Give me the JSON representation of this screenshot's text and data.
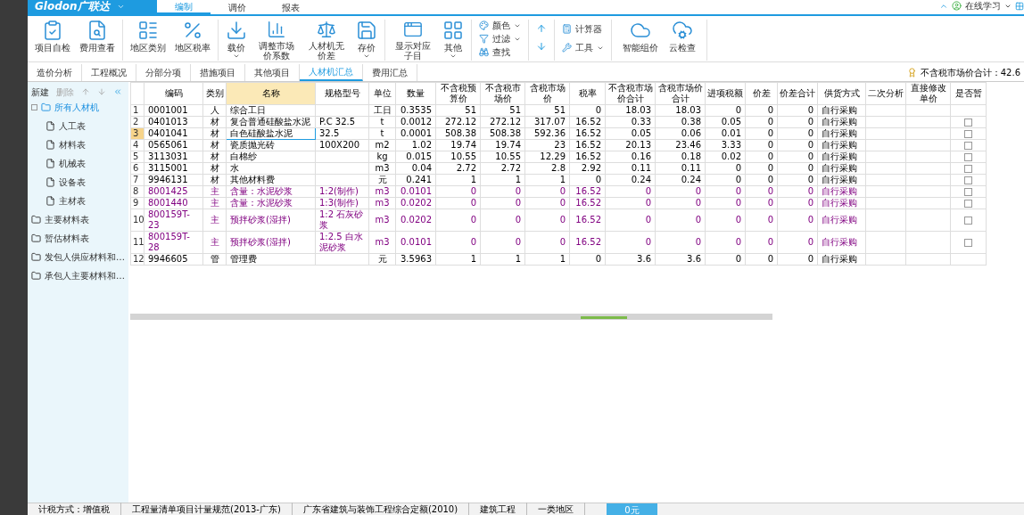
{
  "app": {
    "logo": "Glodon广联达",
    "menu_tabs": [
      {
        "label": "编制",
        "selected": true
      },
      {
        "label": "调价",
        "selected": false
      },
      {
        "label": "报表",
        "selected": false
      }
    ],
    "online_learning": "在线学习"
  },
  "ribbon": {
    "groups": [
      {
        "items": [
          {
            "label": "项目自检",
            "dropdown": false
          },
          {
            "label": "费用查看",
            "dropdown": false
          }
        ]
      },
      {
        "items": [
          {
            "label": "地区类别",
            "dropdown": false
          },
          {
            "label": "地区税率",
            "dropdown": false
          }
        ]
      },
      {
        "items": [
          {
            "label": "载价",
            "dropdown": true
          },
          {
            "label": "调整市场价系数",
            "dropdown": false
          },
          {
            "label": "人材机无价差",
            "dropdown": false
          },
          {
            "label": "存价",
            "dropdown": true
          }
        ]
      },
      {
        "items": [
          {
            "label": "显示对应子目",
            "dropdown": false
          },
          {
            "label": "其他",
            "dropdown": true
          }
        ]
      }
    ],
    "small_items": [
      {
        "label": "颜色",
        "dropdown": true
      },
      {
        "label": "过滤",
        "dropdown": true
      },
      {
        "label": "查找",
        "dropdown": false
      }
    ],
    "tool_items": [
      {
        "label": "计算器",
        "dropdown": false
      },
      {
        "label": "工具",
        "dropdown": true
      }
    ],
    "end_items": [
      {
        "label": "智能组价",
        "dropdown": false
      },
      {
        "label": "云检查",
        "dropdown": false
      }
    ]
  },
  "view_tabs": [
    {
      "label": "造价分析",
      "selected": false
    },
    {
      "label": "工程概况",
      "selected": false
    },
    {
      "label": "分部分项",
      "selected": false
    },
    {
      "label": "措施项目",
      "selected": false
    },
    {
      "label": "其他项目",
      "selected": false
    },
    {
      "label": "人材机汇总",
      "selected": true
    },
    {
      "label": "费用汇总",
      "selected": false
    }
  ],
  "total": "不含税市场价合计：42.6",
  "sidebar": {
    "toolbar": [
      "新建",
      "删除"
    ],
    "tree": [
      {
        "label": "所有人材机",
        "selected": true,
        "expanded": true,
        "children": [
          {
            "label": "人工表",
            "selected": false
          },
          {
            "label": "材料表",
            "selected": false
          },
          {
            "label": "机械表",
            "selected": false
          },
          {
            "label": "设备表",
            "selected": false
          },
          {
            "label": "主材表",
            "selected": false
          }
        ]
      },
      {
        "label": "主要材料表",
        "selected": false
      },
      {
        "label": "暂估材料表",
        "selected": false
      },
      {
        "label": "发包人供应材料和…",
        "selected": false
      },
      {
        "label": "承包人主要材料和…",
        "selected": false
      }
    ]
  },
  "table": {
    "columns": [
      "编码",
      "类别",
      "名称",
      "规格型号",
      "单位",
      "数量",
      "不含税预算价",
      "不含税市场价",
      "含税市场价",
      "税率",
      "不含税市场价合计",
      "含税市场价合计",
      "进项税额",
      "价差",
      "价差合计",
      "供货方式",
      "二次分析",
      "直接修改单价",
      "是否暂"
    ],
    "rows": [
      {
        "no": "1",
        "selected": false,
        "kind": "normal",
        "cells": [
          "0001001",
          "人",
          "综合工日",
          "",
          "工日",
          "0.3535",
          "51",
          "51",
          "51",
          "0",
          "18.03",
          "18.03",
          "0",
          "0",
          "0",
          "自行采购",
          "",
          ""
        ]
      },
      {
        "no": "2",
        "selected": false,
        "kind": "normal",
        "provisional": false,
        "cells": [
          "0401013",
          "材",
          "复合普通硅酸盐水泥",
          "P.C 32.5",
          "t",
          "0.0012",
          "272.12",
          "272.12",
          "317.07",
          "16.52",
          "0.33",
          "0.38",
          "0.05",
          "0",
          "0",
          "自行采购",
          "",
          ""
        ]
      },
      {
        "no": "3",
        "selected": true,
        "kind": "normal",
        "provisional": false,
        "cells": [
          "0401041",
          "材",
          "白色硅酸盐水泥",
          "32.5",
          "t",
          "0.0001",
          "508.38",
          "508.38",
          "592.36",
          "16.52",
          "0.05",
          "0.06",
          "0.01",
          "0",
          "0",
          "自行采购",
          "",
          ""
        ]
      },
      {
        "no": "4",
        "selected": false,
        "kind": "normal",
        "provisional": false,
        "cells": [
          "0565061",
          "材",
          "瓷质抛光砖",
          "100X200",
          "m2",
          "1.02",
          "19.74",
          "19.74",
          "23",
          "16.52",
          "20.13",
          "23.46",
          "3.33",
          "0",
          "0",
          "自行采购",
          "",
          ""
        ]
      },
      {
        "no": "5",
        "selected": false,
        "kind": "normal",
        "provisional": false,
        "cells": [
          "3113031",
          "材",
          "白棉纱",
          "",
          "kg",
          "0.015",
          "10.55",
          "10.55",
          "12.29",
          "16.52",
          "0.16",
          "0.18",
          "0.02",
          "0",
          "0",
          "自行采购",
          "",
          ""
        ]
      },
      {
        "no": "6",
        "selected": false,
        "kind": "normal",
        "provisional": false,
        "cells": [
          "3115001",
          "材",
          "水",
          "",
          "m3",
          "0.04",
          "2.72",
          "2.72",
          "2.8",
          "2.92",
          "0.11",
          "0.11",
          "0",
          "0",
          "0",
          "自行采购",
          "",
          ""
        ]
      },
      {
        "no": "7",
        "selected": false,
        "kind": "normal",
        "provisional": false,
        "cells": [
          "9946131",
          "材",
          "其他材料费",
          "",
          "元",
          "0.241",
          "1",
          "1",
          "1",
          "0",
          "0.24",
          "0.24",
          "0",
          "0",
          "0",
          "自行采购",
          "",
          ""
        ]
      },
      {
        "no": "8",
        "selected": false,
        "kind": "main",
        "provisional": false,
        "cells": [
          "8001425",
          "主",
          "含量：水泥砂浆",
          "1:2(制作)",
          "m3",
          "0.0101",
          "0",
          "0",
          "0",
          "16.52",
          "0",
          "0",
          "0",
          "0",
          "0",
          "自行采购",
          "",
          ""
        ]
      },
      {
        "no": "9",
        "selected": false,
        "kind": "main",
        "provisional": false,
        "cells": [
          "8001440",
          "主",
          "含量：水泥砂浆",
          "1:3(制作)",
          "m3",
          "0.0202",
          "0",
          "0",
          "0",
          "16.52",
          "0",
          "0",
          "0",
          "0",
          "0",
          "自行采购",
          "",
          ""
        ]
      },
      {
        "no": "10",
        "selected": false,
        "kind": "main",
        "provisional": false,
        "cells": [
          "800159T-23",
          "主",
          "预拌砂浆(湿拌)",
          "1:2 石灰砂浆",
          "m3",
          "0.0202",
          "0",
          "0",
          "0",
          "16.52",
          "0",
          "0",
          "0",
          "0",
          "0",
          "自行采购",
          "",
          ""
        ]
      },
      {
        "no": "11",
        "selected": false,
        "kind": "main",
        "provisional": false,
        "cells": [
          "800159T-28",
          "主",
          "预拌砂浆(湿拌)",
          "1:2.5 白水泥砂浆",
          "m3",
          "0.0101",
          "0",
          "0",
          "0",
          "16.52",
          "0",
          "0",
          "0",
          "0",
          "0",
          "自行采购",
          "",
          ""
        ]
      },
      {
        "no": "12",
        "selected": false,
        "kind": "normal",
        "cells": [
          "9946605",
          "管",
          "管理费",
          "",
          "元",
          "3.5963",
          "1",
          "1",
          "1",
          "0",
          "3.6",
          "3.6",
          "0",
          "0",
          "0",
          "自行采购",
          "",
          ""
        ]
      }
    ]
  },
  "status_bar": [
    "计税方式：增值税",
    "工程量清单项目计量规范(2013-广东)",
    "广东省建筑与装饰工程综合定额(2010)",
    "建筑工程",
    "一类地区"
  ],
  "status_button": "0元"
}
